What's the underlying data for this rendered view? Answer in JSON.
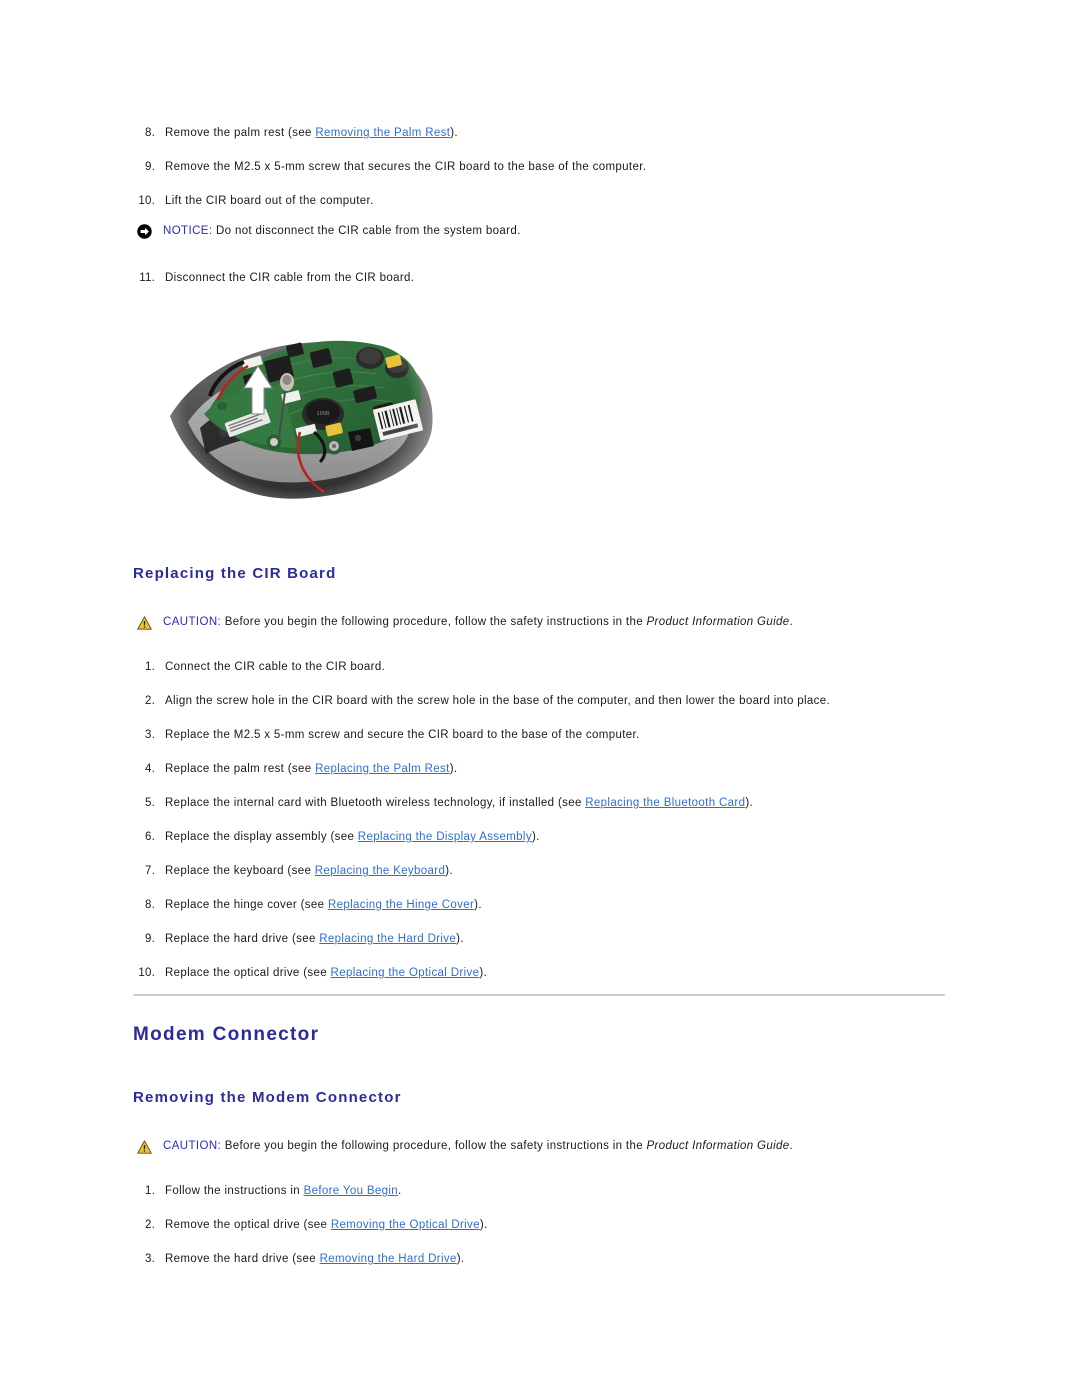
{
  "document": {
    "type": "service-manual-page",
    "background": "#ffffff",
    "heading_color": "#2b2b9e",
    "link_color": "#2f6fd0",
    "label_color": "#2b2bbd",
    "rule_color": "#cfcfd3"
  },
  "removing_cir_steps": [
    {
      "num": "8.",
      "pre": "Remove the palm rest (see ",
      "link": "Removing the Palm Rest",
      "post": ")."
    },
    {
      "num": "9.",
      "pre": "Remove the M2.5 x 5-mm screw that secures the CIR board to the base of the computer.",
      "link": "",
      "post": ""
    },
    {
      "num": "10.",
      "pre": "Lift the CIR board out of the computer.",
      "link": "",
      "post": ""
    }
  ],
  "notice": {
    "icon": "notice-arrow-icon",
    "label": "NOTICE:",
    "text": " Do not disconnect the CIR cable from the system board."
  },
  "step_eleven": {
    "num": "11.",
    "pre": "Disconnect the CIR cable from the CIR board.",
    "link": "",
    "post": ""
  },
  "figure": {
    "name": "cir-board-removal-photo",
    "alt": "Photograph of the green CIR board seated in the base of the computer with a white arrow indicating the lift direction"
  },
  "replacing_section": {
    "heading": "Replacing the CIR Board",
    "caution": {
      "icon": "caution-triangle-icon",
      "label": "CAUTION:",
      "text_before": " Before you begin the following procedure, follow the safety instructions in the ",
      "italic": "Product Information Guide",
      "text_after": "."
    },
    "steps": [
      {
        "num": "1.",
        "pre": "Connect the CIR cable to the CIR board.",
        "link": "",
        "post": ""
      },
      {
        "num": "2.",
        "pre": "Align the screw hole in the CIR board with the screw hole in the base of the computer, and then lower the board into place.",
        "link": "",
        "post": ""
      },
      {
        "num": "3.",
        "pre": "Replace the M2.5 x 5-mm screw and secure the CIR board to the base of the computer.",
        "link": "",
        "post": ""
      },
      {
        "num": "4.",
        "pre": "Replace the palm rest (see ",
        "link": "Replacing the Palm Rest",
        "post": ")."
      },
      {
        "num": "5.",
        "pre": "Replace the internal card with Bluetooth wireless technology, if installed (see ",
        "link": "Replacing the Bluetooth Card",
        "post": ")."
      },
      {
        "num": "6.",
        "pre": "Replace the display assembly (see ",
        "link": "Replacing the Display Assembly",
        "post": ")."
      },
      {
        "num": "7.",
        "pre": "Replace the keyboard (see ",
        "link": "Replacing the Keyboard",
        "post": ")."
      },
      {
        "num": "8.",
        "pre": "Replace the hinge cover (see ",
        "link": "Replacing the Hinge Cover",
        "post": ")."
      },
      {
        "num": "9.",
        "pre": "Replace the hard drive (see ",
        "link": "Replacing the Hard Drive",
        "post": ")."
      },
      {
        "num": "10.",
        "pre": "Replace the optical drive (see ",
        "link": "Replacing the Optical Drive",
        "post": ")."
      }
    ]
  },
  "modem_section": {
    "heading": "Modem Connector",
    "subheading": "Removing the Modem Connector",
    "caution": {
      "icon": "caution-triangle-icon",
      "label": "CAUTION:",
      "text_before": " Before you begin the following procedure, follow the safety instructions in the ",
      "italic": "Product Information Guide",
      "text_after": "."
    },
    "steps": [
      {
        "num": "1.",
        "pre": "Follow the instructions in ",
        "link": "Before You Begin",
        "post": "."
      },
      {
        "num": "2.",
        "pre": "Remove the optical drive (see ",
        "link": "Removing the Optical Drive",
        "post": ")."
      },
      {
        "num": "3.",
        "pre": "Remove the hard drive (see ",
        "link": "Removing the Hard Drive",
        "post": ")."
      }
    ]
  }
}
